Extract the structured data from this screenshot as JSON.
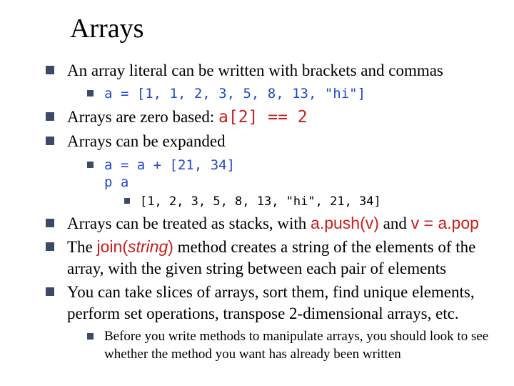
{
  "title": "Arrays",
  "b1": {
    "text": "An array literal can be written with brackets and commas",
    "sub1_code": "a = [1, 1, 2, 3, 5, 8, 13, \"hi\"]"
  },
  "b2": {
    "pre": "Arrays are zero based: ",
    "code": "a[2] == 2"
  },
  "b3": {
    "text": "Arrays can be expanded",
    "sub_code": "a = a + [21, 34]\np a",
    "output": "[1, 2, 3, 5, 8, 13, \"hi\", 21, 34]"
  },
  "b4": {
    "pre": "Arrays can be treated as stacks, with ",
    "code1": "a.push(v)",
    "mid": " and ",
    "code2": "v = a.pop"
  },
  "b5": {
    "pre": "The ",
    "method": "join",
    "paren_open": "(",
    "arg": "string",
    "paren_close": ")",
    "post": " method creates a string of the elements of the array, with the given string between each pair of elements"
  },
  "b6": {
    "text": "You can take slices of arrays, sort them, find unique elements, perform set operations, transpose 2-dimensional arrays, etc.",
    "sub": "Before you write methods to manipulate arrays, you should look to see whether the method you want has already been written"
  }
}
